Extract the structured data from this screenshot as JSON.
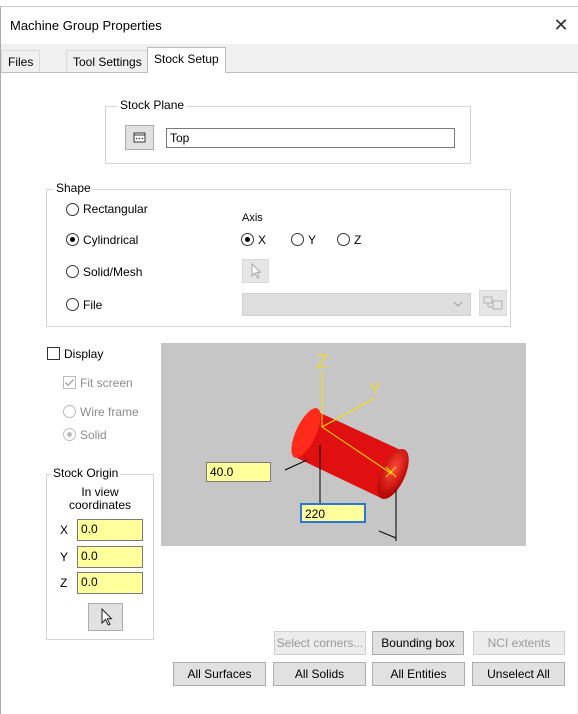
{
  "window": {
    "title": "Machine Group Properties",
    "close_glyph": "✕"
  },
  "tabs": [
    "Files",
    "Tool Settings",
    "Stock Setup"
  ],
  "active_tab": "Stock Setup",
  "stock_plane": {
    "label": "Stock Plane",
    "value": "Top"
  },
  "shape": {
    "label": "Shape",
    "options": [
      "Rectangular",
      "Cylindrical",
      "Solid/Mesh",
      "File"
    ],
    "selected": "Cylindrical",
    "axis": {
      "label": "Axis",
      "options": [
        "X",
        "Y",
        "Z"
      ],
      "selected": "X"
    },
    "file_dropdown_value": ""
  },
  "display": {
    "label": "Display",
    "checked": false,
    "fit_screen": {
      "label": "Fit screen",
      "checked": true
    },
    "wire_frame_label": "Wire frame",
    "solid_label": "Solid",
    "render_mode": "Solid"
  },
  "stock_origin": {
    "label": "Stock Origin",
    "sublabel_line1": "In view",
    "sublabel_line2": "coordinates",
    "x_label": "X",
    "x": "0.0",
    "y_label": "Y",
    "y": "0.0",
    "z_label": "Z",
    "z": "0.0"
  },
  "preview": {
    "diameter": "40.0",
    "length": "220",
    "axis_labels": {
      "x": "X",
      "y": "Y",
      "z": "Z"
    },
    "colors": {
      "background": "#c6c6c6",
      "stock": "#e01010",
      "axes": "#f5e000",
      "input": "#ffff9c"
    }
  },
  "buttons": {
    "select_corners": "Select corners...",
    "bounding_box": "Bounding box",
    "nci_extents": "NCI extents",
    "all_surfaces": "All Surfaces",
    "all_solids": "All Solids",
    "all_entities": "All Entities",
    "unselect_all": "Unselect All"
  }
}
